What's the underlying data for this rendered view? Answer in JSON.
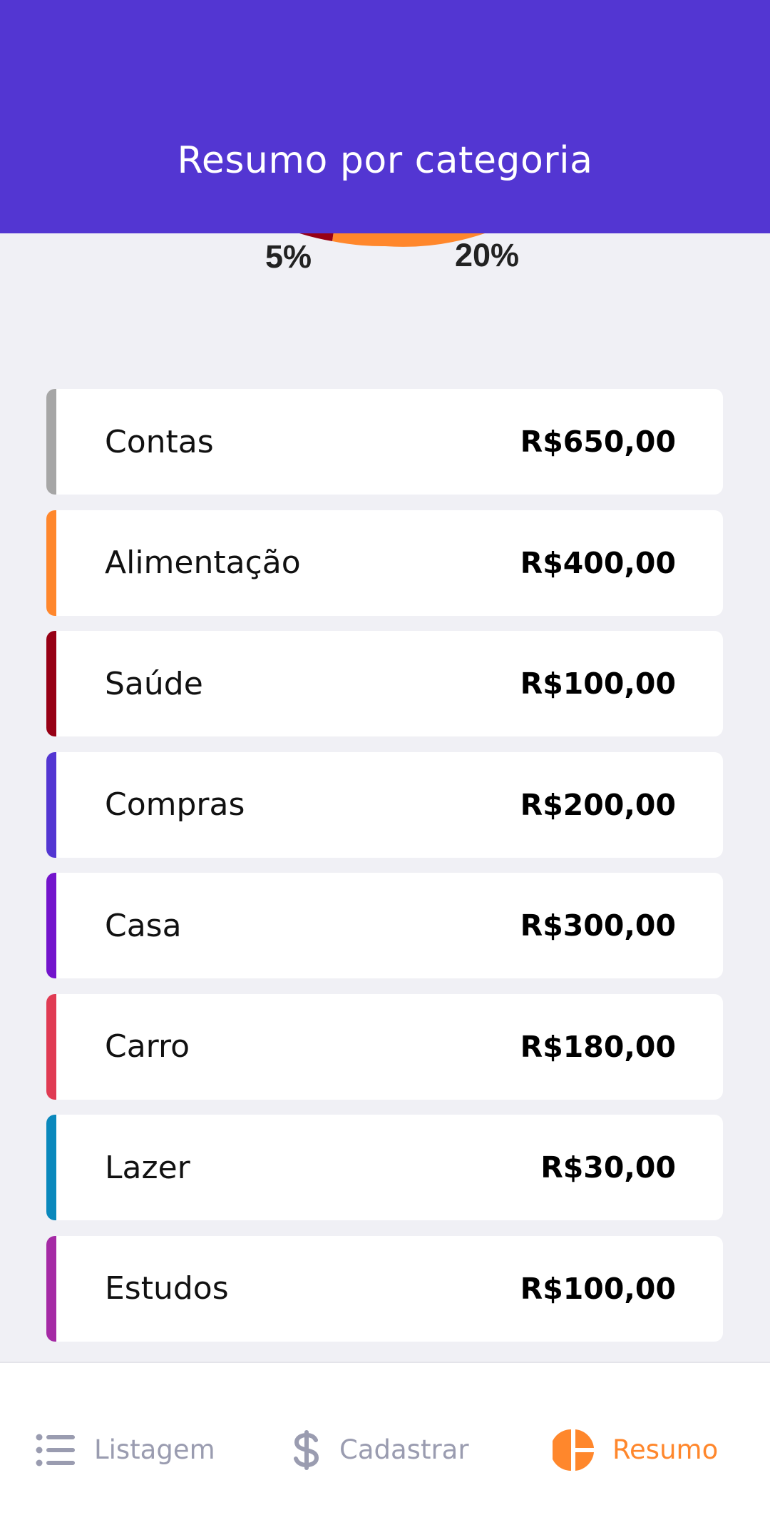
{
  "header": {
    "title": "Resumo por categoria"
  },
  "pie": {
    "visible_percent_labels": [
      "5%",
      "20%"
    ],
    "visible_slices": [
      {
        "category": "Saúde",
        "color": "#970015"
      },
      {
        "category": "Alimentação",
        "color": "#ff872c"
      }
    ]
  },
  "categories": [
    {
      "name": "Contas",
      "amount": "R$650,00",
      "color": "#a6a6a6"
    },
    {
      "name": "Alimentação",
      "amount": "R$400,00",
      "color": "#ff872c"
    },
    {
      "name": "Saúde",
      "amount": "R$100,00",
      "color": "#970015"
    },
    {
      "name": "Compras",
      "amount": "R$200,00",
      "color": "#5336d2"
    },
    {
      "name": "Casa",
      "amount": "R$300,00",
      "color": "#7314cc"
    },
    {
      "name": "Carro",
      "amount": "R$180,00",
      "color": "#e03b53"
    },
    {
      "name": "Lazer",
      "amount": "R$30,00",
      "color": "#0a88bc"
    },
    {
      "name": "Estudos",
      "amount": "R$100,00",
      "color": "#a52aa5"
    }
  ],
  "bottom_nav": {
    "items": [
      {
        "label": "Listagem",
        "icon": "list-icon",
        "active": false
      },
      {
        "label": "Cadastrar",
        "icon": "dollar-sign-icon",
        "active": false
      },
      {
        "label": "Resumo",
        "icon": "pie-chart-icon",
        "active": true
      }
    ],
    "active_color": "#ff872c",
    "inactive_color": "#9a9cb0"
  }
}
